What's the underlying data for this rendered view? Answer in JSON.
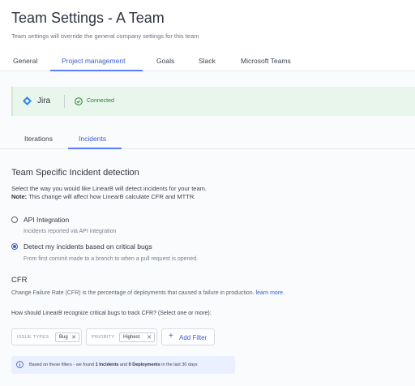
{
  "header": {
    "title": "Team Settings - A Team",
    "subtitle": "Team settings will override the general company settings for this team"
  },
  "tabs": [
    {
      "label": "General",
      "active": false
    },
    {
      "label": "Project management",
      "active": true
    },
    {
      "label": "Goals",
      "active": false
    },
    {
      "label": "Slack",
      "active": false
    },
    {
      "label": "Microsoft Teams",
      "active": false
    }
  ],
  "integration": {
    "name": "Jira",
    "status": "Connected",
    "icon": "jira-icon",
    "status_icon": "check-circle-icon",
    "status_color": "#2e7d32",
    "background_color": "#e9f6ec"
  },
  "subtabs": [
    {
      "label": "Iterations",
      "active": false
    },
    {
      "label": "Incidents",
      "active": true
    }
  ],
  "incident_detection": {
    "title": "Team Specific Incident detection",
    "description": "Select the way you would like LinearB will detect incidents for your team.",
    "note_label": "Note:",
    "note_text": "This change will affect how LinearB calculate CFR and MTTR.",
    "options": [
      {
        "label": "API Integration",
        "hint": "Incidents reported via API integration",
        "selected": false
      },
      {
        "label": "Detect my incidents based on critical bugs",
        "hint": "From first commit made to a branch to when a pull request is opened.",
        "selected": true
      }
    ]
  },
  "cfr": {
    "title": "CFR",
    "description": "Change Failure Rate (CFR) is the percentage of deployments that caused a failure in production.",
    "learn_more": "learn more",
    "question": "How should LinearB recognize critical bugs to track CFR? (Select one or more):"
  },
  "filters": [
    {
      "label": "ISSUE TYPES",
      "chips": [
        "Bug"
      ]
    },
    {
      "label": "PRIORITY",
      "chips": [
        "Highest"
      ]
    }
  ],
  "add_filter_label": "Add Filter",
  "info": {
    "prefix": "Based on these filters - we found ",
    "incidents_count": "1",
    "incidents_label": "Incidents",
    "and_text": " and ",
    "deployments_count": "0",
    "deployments_label": "Deployments",
    "suffix": " in the last 30 days"
  },
  "colors": {
    "accent": "#3b5bdb",
    "connected_bg": "#e9f6ec",
    "info_bg": "#eaf0ff"
  }
}
